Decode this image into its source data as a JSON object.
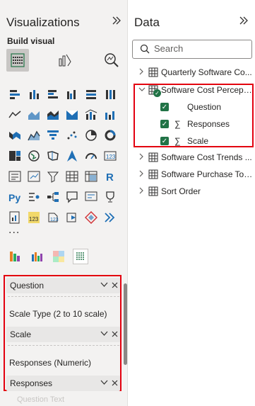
{
  "visualizations": {
    "title": "Visualizations",
    "collapse_icon": "double-chevron-right-icon",
    "build_visual_label": "Build visual",
    "more_label": "...",
    "wells": [
      {
        "label": "Question",
        "value": "Scale Type (2 to 10 scale)"
      },
      {
        "label": "Scale",
        "value": "Responses (Numeric)"
      },
      {
        "label": "Responses"
      }
    ],
    "faded_text": "Question Text"
  },
  "data": {
    "title": "Data",
    "collapse_icon": "double-chevron-right-icon",
    "search_placeholder": "Search",
    "tables": [
      {
        "label": "Quarterly Software Co...",
        "expanded": false
      },
      {
        "label": "Software Cost Percept...",
        "expanded": true,
        "fields": [
          {
            "label": "Question",
            "checked": true,
            "sigma": false
          },
          {
            "label": "Responses",
            "checked": true,
            "sigma": true
          },
          {
            "label": "Scale",
            "checked": true,
            "sigma": true
          }
        ]
      },
      {
        "label": "Software Cost Trends ...",
        "expanded": false
      },
      {
        "label": "Software Purchase Tot...",
        "expanded": false
      },
      {
        "label": "Sort Order",
        "expanded": false
      }
    ]
  },
  "colors": {
    "highlight": "#e3000f",
    "check": "#217346"
  }
}
